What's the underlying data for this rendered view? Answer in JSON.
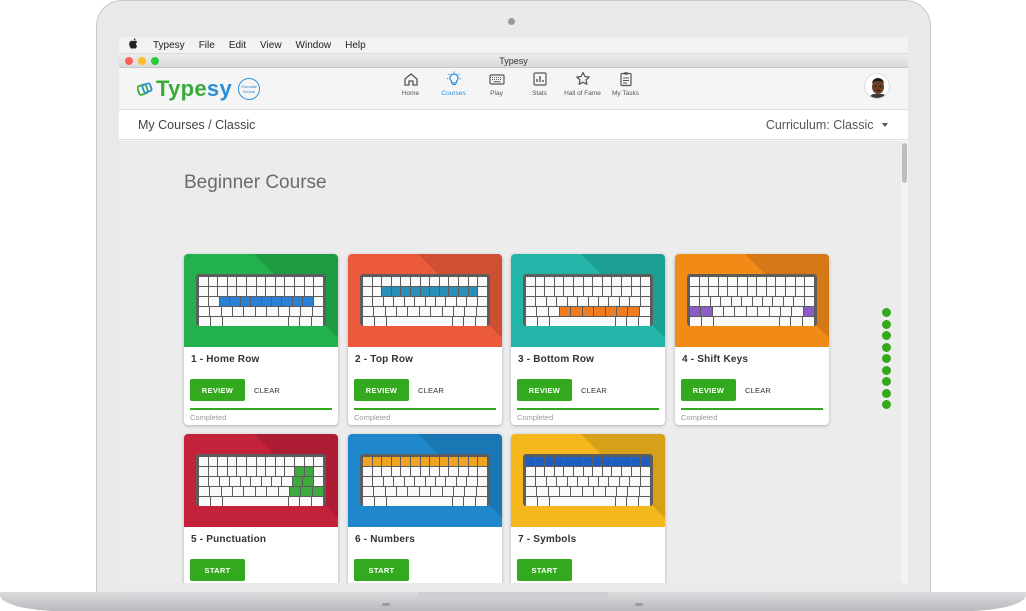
{
  "menubar": {
    "items": [
      "Typesy",
      "File",
      "Edit",
      "View",
      "Window",
      "Help"
    ]
  },
  "window": {
    "title": "Typesy"
  },
  "logo": {
    "text_a": "Type",
    "text_b": "sy",
    "badge": "Glendale School"
  },
  "nav": [
    {
      "label": "Home",
      "icon": "home-icon",
      "active": false
    },
    {
      "label": "Courses",
      "icon": "lightbulb-icon",
      "active": true
    },
    {
      "label": "Play",
      "icon": "keyboard-icon",
      "active": false
    },
    {
      "label": "Stats",
      "icon": "stats-icon",
      "active": false
    },
    {
      "label": "Hall of Fame",
      "icon": "star-icon",
      "active": false
    },
    {
      "label": "My Tasks",
      "icon": "clipboard-icon",
      "active": false
    }
  ],
  "breadcrumb": "My Courses / Classic",
  "curriculum": {
    "label": "Curriculum:",
    "value": "Classic"
  },
  "section_title": "Beginner Course",
  "cards": [
    {
      "title": "1 - Home Row",
      "color": "#23b14d",
      "highlight": "#2a7fd6",
      "action": "REVIEW",
      "clear": "CLEAR",
      "status": "Completed"
    },
    {
      "title": "2 - Top Row",
      "color": "#ec5a3c",
      "highlight": "#2a8fb6",
      "action": "REVIEW",
      "clear": "CLEAR",
      "status": "Completed"
    },
    {
      "title": "3 - Bottom Row",
      "color": "#22b5a8",
      "highlight": "#f07c21",
      "action": "REVIEW",
      "clear": "CLEAR",
      "status": "Completed"
    },
    {
      "title": "4 - Shift Keys",
      "color": "#f28a18",
      "highlight": "#8a5bc9",
      "action": "REVIEW",
      "clear": "CLEAR",
      "status": "Completed"
    },
    {
      "title": "5 - Punctuation",
      "color": "#c4213b",
      "highlight": "#3caa3c",
      "action": "START",
      "clear": "",
      "status": ""
    },
    {
      "title": "6 - Numbers",
      "color": "#1f88cc",
      "highlight": "#f0a41f",
      "action": "START",
      "clear": "",
      "status": ""
    },
    {
      "title": "7 - Symbols",
      "color": "#f4b81d",
      "highlight": "#1f5fc2",
      "action": "START",
      "clear": "",
      "status": ""
    }
  ],
  "pagination_count": 9,
  "colors": {
    "accent": "#33a91d",
    "brand_blue": "#2a8fd6"
  }
}
